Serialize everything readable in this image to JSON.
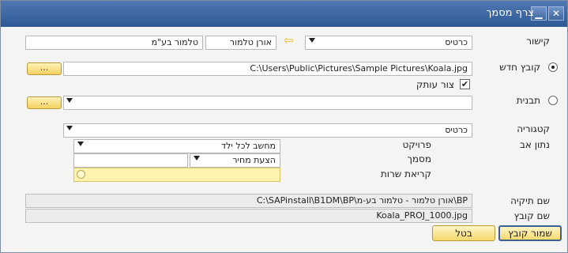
{
  "window": {
    "title": "צרף מסמך",
    "close_symbol": "✕",
    "minimize_symbol": "▁"
  },
  "link": {
    "label": "קישור",
    "type_value": "כרטיס",
    "arrow_symbol": "⇦",
    "code_value": "אורן טלמור",
    "name_value": "טלמור בע\"מ"
  },
  "new_file": {
    "label": "קובץ חדש",
    "path": "C:\\Users\\Public\\Pictures\\Sample Pictures\\Koala.jpg",
    "browse_label": "...",
    "checked": true
  },
  "attach_copy": {
    "label": "צור עותק",
    "check_symbol": "✔"
  },
  "template": {
    "label": "תבנית",
    "value": "",
    "browse_label": "..."
  },
  "category": {
    "label": "קטגוריה",
    "value": "כרטיס"
  },
  "parent": {
    "label": "נתון אב",
    "project_label": "פרויקט",
    "project_value": "מחשב לכל ילד",
    "document_label": "מסמך",
    "document_type_value": "הצעת מחיר",
    "document_number_value": "",
    "service_call_label": "קריאת שרות",
    "service_call_value": ""
  },
  "folder": {
    "label": "שם תיקיה",
    "value": "C:\\SAPinstall\\B1DM\\BP\\אורן טלמור - טלמור בע-מ\\BP"
  },
  "file_name": {
    "label": "שם קובץ",
    "value": "Koala_PROJ_1000.jpg"
  },
  "buttons": {
    "save": "שמור קובץ",
    "cancel": "בטל"
  },
  "colors": {
    "titlebar": "#3a66a3",
    "button_yellow": "#f5d76b",
    "highlight_field": "#fff3b0"
  }
}
